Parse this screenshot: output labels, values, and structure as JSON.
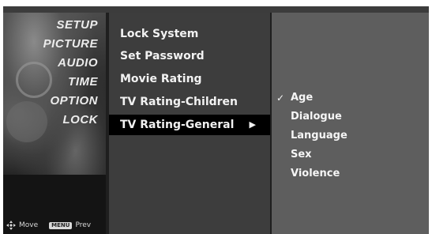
{
  "main_menu": {
    "items": [
      {
        "label": "SETUP"
      },
      {
        "label": "PICTURE"
      },
      {
        "label": "AUDIO"
      },
      {
        "label": "TIME"
      },
      {
        "label": "OPTION"
      },
      {
        "label": "LOCK"
      }
    ],
    "selected": "LOCK"
  },
  "footer": {
    "move_label": "Move",
    "menu_key_label": "MENU",
    "prev_label": "Prev"
  },
  "lock_menu": {
    "items": [
      {
        "label": "Lock System"
      },
      {
        "label": "Set Password"
      },
      {
        "label": "Movie Rating"
      },
      {
        "label": "TV Rating-Children"
      },
      {
        "label": "TV Rating-General",
        "arrow": "▶"
      }
    ],
    "selected": "TV Rating-General"
  },
  "tv_rating_general": {
    "items": [
      {
        "label": "Age",
        "check": "✓"
      },
      {
        "label": "Dialogue"
      },
      {
        "label": "Language"
      },
      {
        "label": "Sex"
      },
      {
        "label": "Violence"
      }
    ],
    "selected": "Age"
  },
  "colors": {
    "sidebar_bg": "#141414",
    "submenu_bg": "#3d3d3d",
    "options_bg": "#5e5e5e",
    "highlight_bg": "#000000",
    "text": "#f2f2f2"
  },
  "icons": {
    "move": "four-way-arrow-icon",
    "check": "check-icon",
    "submenu_arrow": "triangle-right-icon"
  }
}
